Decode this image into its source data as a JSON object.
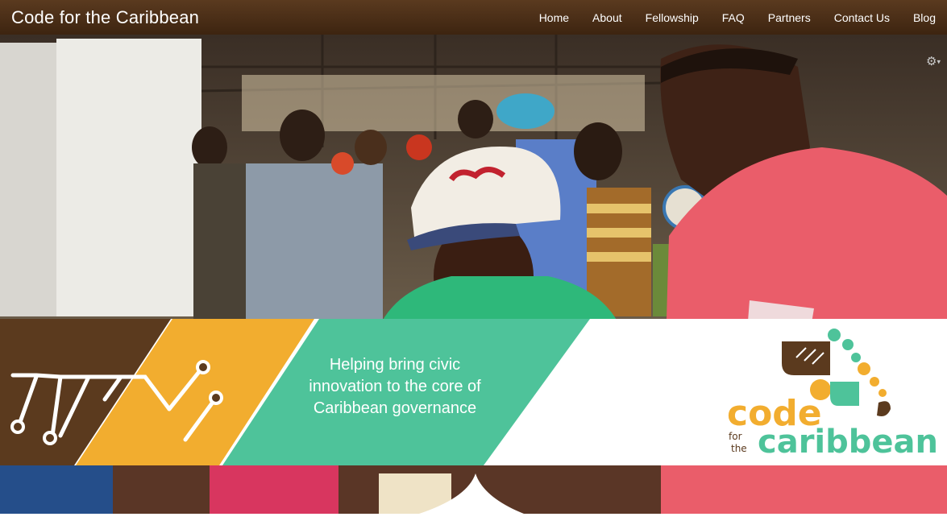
{
  "site": {
    "brand": "Code for the Caribbean"
  },
  "nav": {
    "items": [
      "Home",
      "About",
      "Fellowship",
      "FAQ",
      "Partners",
      "Contact Us",
      "Blog"
    ]
  },
  "hero": {
    "tagline_lines": [
      "Helping bring civic",
      "innovation to the core of",
      "Caribbean governance"
    ],
    "logo": {
      "word1": "code",
      "word2": "for",
      "word3": "the",
      "word4": "caribbean"
    }
  },
  "colors": {
    "nav_bg": "#4b2f18",
    "brown": "#5b3a1e",
    "orange": "#f2ad2f",
    "teal": "#4ec39a",
    "white": "#ffffff"
  },
  "icons": {
    "settings": "gear-icon"
  }
}
